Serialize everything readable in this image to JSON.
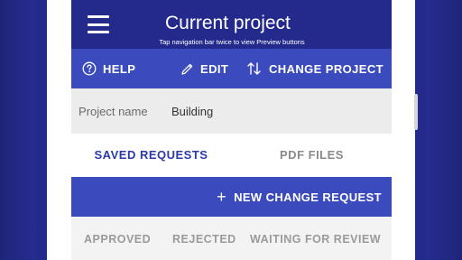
{
  "app": {
    "title": "Current project",
    "hint": "Tap navigation bar twice to view Preview buttons"
  },
  "toolbar": {
    "help_label": "HELP",
    "edit_label": "EDIT",
    "change_project_label": "CHANGE PROJECT"
  },
  "project": {
    "field_label": "Project name",
    "field_value": "Building"
  },
  "tabs": [
    {
      "label": "SAVED REQUESTS",
      "active": true
    },
    {
      "label": "PDF FILES",
      "active": false
    }
  ],
  "new_request_label": "NEW CHANGE REQUEST",
  "filters": [
    {
      "label": "APPROVED"
    },
    {
      "label": "REJECTED"
    },
    {
      "label": "WAITING FOR REVIEW"
    }
  ],
  "icons": {
    "menu": "hamburger-menu-icon",
    "help": "help-circle-icon",
    "edit": "pencil-icon",
    "change": "swap-vertical-icon",
    "add": "plus-icon"
  },
  "colors": {
    "background": "#242a8c",
    "appbar": "#242a8c",
    "accent": "#3b4bbd",
    "active_tab_text": "#2d3aa6",
    "inactive_text": "#8a8a8a"
  }
}
